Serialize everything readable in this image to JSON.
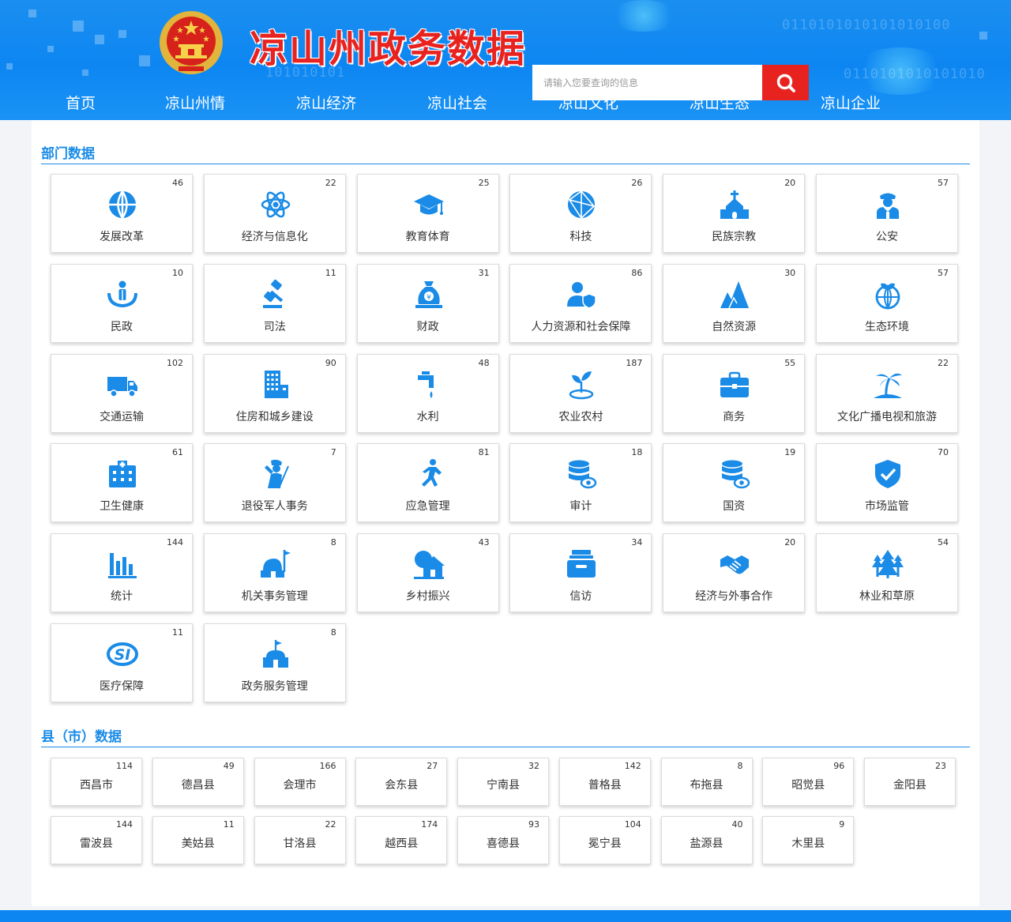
{
  "site": {
    "title": "凉山州政务数据",
    "search_placeholder": "请输入您要查询的信息",
    "binary_1": "0110101010101010100",
    "binary_2": "0110101010101010",
    "binary_3": "101010101",
    "brand_red": "#e8231f",
    "brand_blue": "#0d86f2"
  },
  "nav": [
    "首页",
    "凉山州情",
    "凉山经济",
    "凉山社会",
    "凉山文化",
    "凉山生态",
    "凉山企业"
  ],
  "departments": {
    "title": "部门数据",
    "items": [
      {
        "name": "发展改革",
        "count": "46",
        "icon": "globe-icon"
      },
      {
        "name": "经济与信息化",
        "count": "22",
        "icon": "atom-icon"
      },
      {
        "name": "教育体育",
        "count": "25",
        "icon": "graduation-cap-icon"
      },
      {
        "name": "科技",
        "count": "26",
        "icon": "network-sphere-icon"
      },
      {
        "name": "民族宗教",
        "count": "20",
        "icon": "church-icon"
      },
      {
        "name": "公安",
        "count": "57",
        "icon": "police-officer-icon"
      },
      {
        "name": "民政",
        "count": "10",
        "icon": "hands-person-icon"
      },
      {
        "name": "司法",
        "count": "11",
        "icon": "gavel-icon"
      },
      {
        "name": "财政",
        "count": "31",
        "icon": "money-bag-icon"
      },
      {
        "name": "人力资源和社会保障",
        "count": "86",
        "icon": "user-shield-icon"
      },
      {
        "name": "自然资源",
        "count": "30",
        "icon": "mountains-icon"
      },
      {
        "name": "生态环境",
        "count": "57",
        "icon": "globe-leaf-icon"
      },
      {
        "name": "交通运输",
        "count": "102",
        "icon": "truck-icon"
      },
      {
        "name": "住房和城乡建设",
        "count": "90",
        "icon": "building-icon"
      },
      {
        "name": "水利",
        "count": "48",
        "icon": "faucet-icon"
      },
      {
        "name": "农业农村",
        "count": "187",
        "icon": "sprout-icon"
      },
      {
        "name": "商务",
        "count": "55",
        "icon": "briefcase-icon"
      },
      {
        "name": "文化广播电视和旅游",
        "count": "22",
        "icon": "palm-island-icon"
      },
      {
        "name": "卫生健康",
        "count": "61",
        "icon": "hospital-icon"
      },
      {
        "name": "退役军人事务",
        "count": "7",
        "icon": "soldier-salute-icon"
      },
      {
        "name": "应急管理",
        "count": "81",
        "icon": "running-person-icon"
      },
      {
        "name": "审计",
        "count": "18",
        "icon": "database-eye-icon"
      },
      {
        "name": "国资",
        "count": "19",
        "icon": "database-eye-icon"
      },
      {
        "name": "市场监管",
        "count": "70",
        "icon": "shield-check-icon"
      },
      {
        "name": "统计",
        "count": "144",
        "icon": "bar-chart-icon"
      },
      {
        "name": "机关事务管理",
        "count": "8",
        "icon": "government-building-flag-icon"
      },
      {
        "name": "乡村振兴",
        "count": "43",
        "icon": "village-house-icon"
      },
      {
        "name": "信访",
        "count": "34",
        "icon": "inbox-tray-icon"
      },
      {
        "name": "经济与外事合作",
        "count": "20",
        "icon": "handshake-icon"
      },
      {
        "name": "林业和草原",
        "count": "54",
        "icon": "trees-icon"
      },
      {
        "name": "医疗保障",
        "count": "11",
        "icon": "si-insurance-icon"
      },
      {
        "name": "政务服务管理",
        "count": "8",
        "icon": "hall-flag-icon"
      }
    ]
  },
  "counties": {
    "title": "县（市）数据",
    "items": [
      {
        "name": "西昌市",
        "count": "114"
      },
      {
        "name": "德昌县",
        "count": "49"
      },
      {
        "name": "会理市",
        "count": "166"
      },
      {
        "name": "会东县",
        "count": "27"
      },
      {
        "name": "宁南县",
        "count": "32"
      },
      {
        "name": "普格县",
        "count": "142"
      },
      {
        "name": "布拖县",
        "count": "8"
      },
      {
        "name": "昭觉县",
        "count": "96"
      },
      {
        "name": "金阳县",
        "count": "23"
      },
      {
        "name": "雷波县",
        "count": "144"
      },
      {
        "name": "美姑县",
        "count": "11"
      },
      {
        "name": "甘洛县",
        "count": "22"
      },
      {
        "name": "越西县",
        "count": "174"
      },
      {
        "name": "喜德县",
        "count": "93"
      },
      {
        "name": "冕宁县",
        "count": "104"
      },
      {
        "name": "盐源县",
        "count": "40"
      },
      {
        "name": "木里县",
        "count": "9"
      }
    ]
  }
}
